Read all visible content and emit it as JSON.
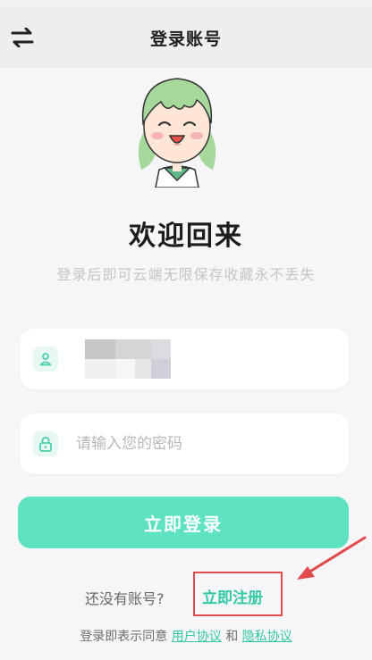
{
  "nav": {
    "title": "登录账号",
    "switch_icon": "swap-arrows-icon"
  },
  "hero": {
    "title": "欢迎回来",
    "subtitle": "登录后即可云端无限保存收藏永不丢失"
  },
  "form": {
    "account_icon": "user-icon",
    "password_icon": "lock-icon",
    "password_placeholder": "请输入您的密码",
    "login_label": "立即登录"
  },
  "register": {
    "prompt": "还没有账号?",
    "link_label": "立即注册"
  },
  "agreement": {
    "prefix": "登录即表示同意",
    "user_agreement": "用户协议",
    "conjunction": "和",
    "privacy_policy": "隐私协议"
  },
  "colors": {
    "accent": "#5ee2c2",
    "accent_text": "#34c8a6",
    "annotation_red": "#e24b4b"
  }
}
